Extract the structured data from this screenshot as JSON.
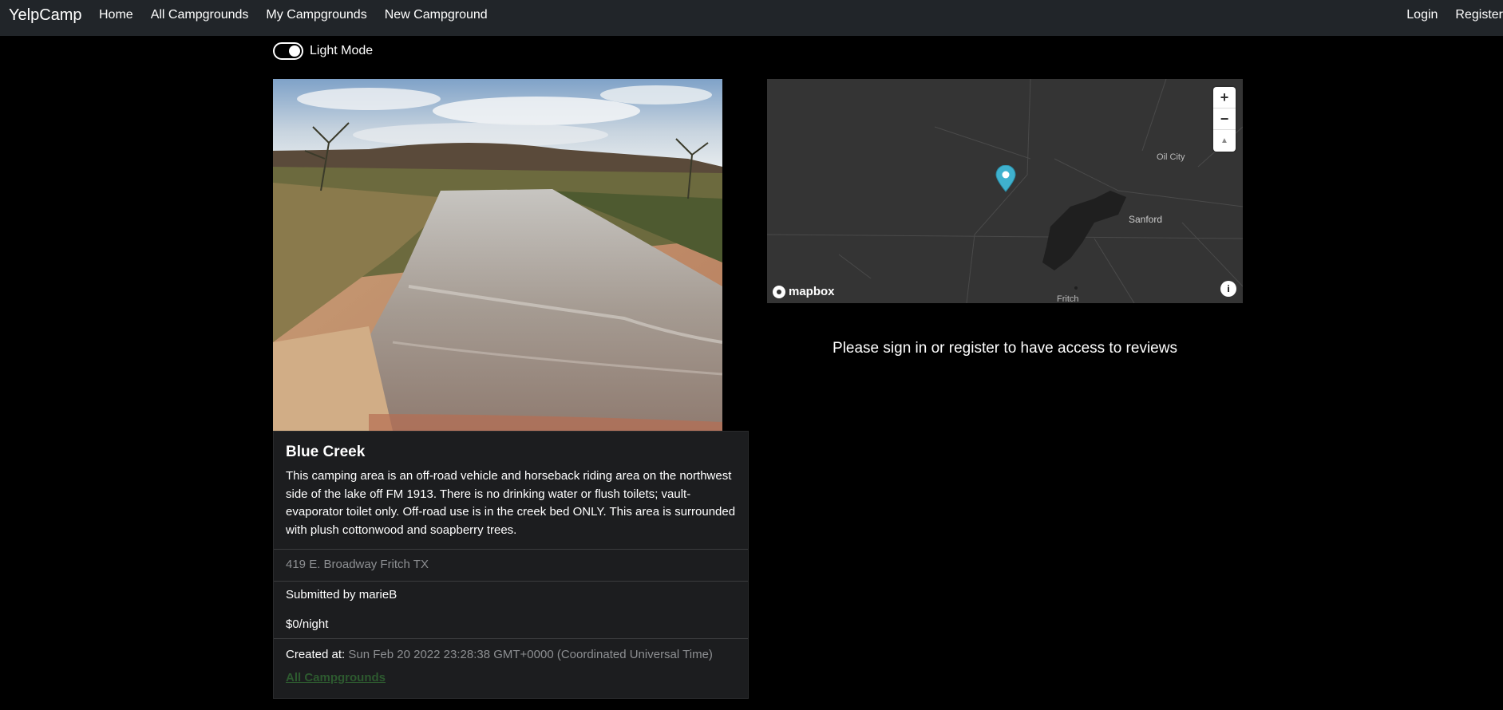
{
  "nav": {
    "brand": "YelpCamp",
    "links": [
      "Home",
      "All Campgrounds",
      "My Campgrounds",
      "New Campground"
    ],
    "right": [
      "Login",
      "Register"
    ]
  },
  "theme_toggle": {
    "label": "Light Mode",
    "checked": true
  },
  "campground": {
    "image_alt": "creek bed with sand and shallow water under a cloudy sky",
    "title": "Blue Creek",
    "description": "This camping area is an off-road vehicle and horseback riding area on the northwest side of the lake off FM 1913. There is no drinking water or flush toilets; vault-evaporator toilet only. Off-road use is in the creek bed ONLY. This area is surrounded with plush cottonwood and soapberry trees.",
    "location": "419 E. Broadway Fritch TX",
    "submitted_by": "Submitted by marieB",
    "price": "$0/night",
    "created_label": "Created at:",
    "created_value": "Sun Feb 20 2022 23:28:38 GMT+0000 (Coordinated Universal Time)",
    "back_link": "All Campgrounds"
  },
  "map": {
    "zoom_in": "+",
    "zoom_out": "−",
    "compass": "▲",
    "logo": "mapbox",
    "info": "i",
    "places": [
      "Oil City",
      "Sanford",
      "Fritch"
    ],
    "marker_color": "#3fb1ce"
  },
  "reviews": {
    "message": "Please sign in or register to have access to reviews"
  }
}
